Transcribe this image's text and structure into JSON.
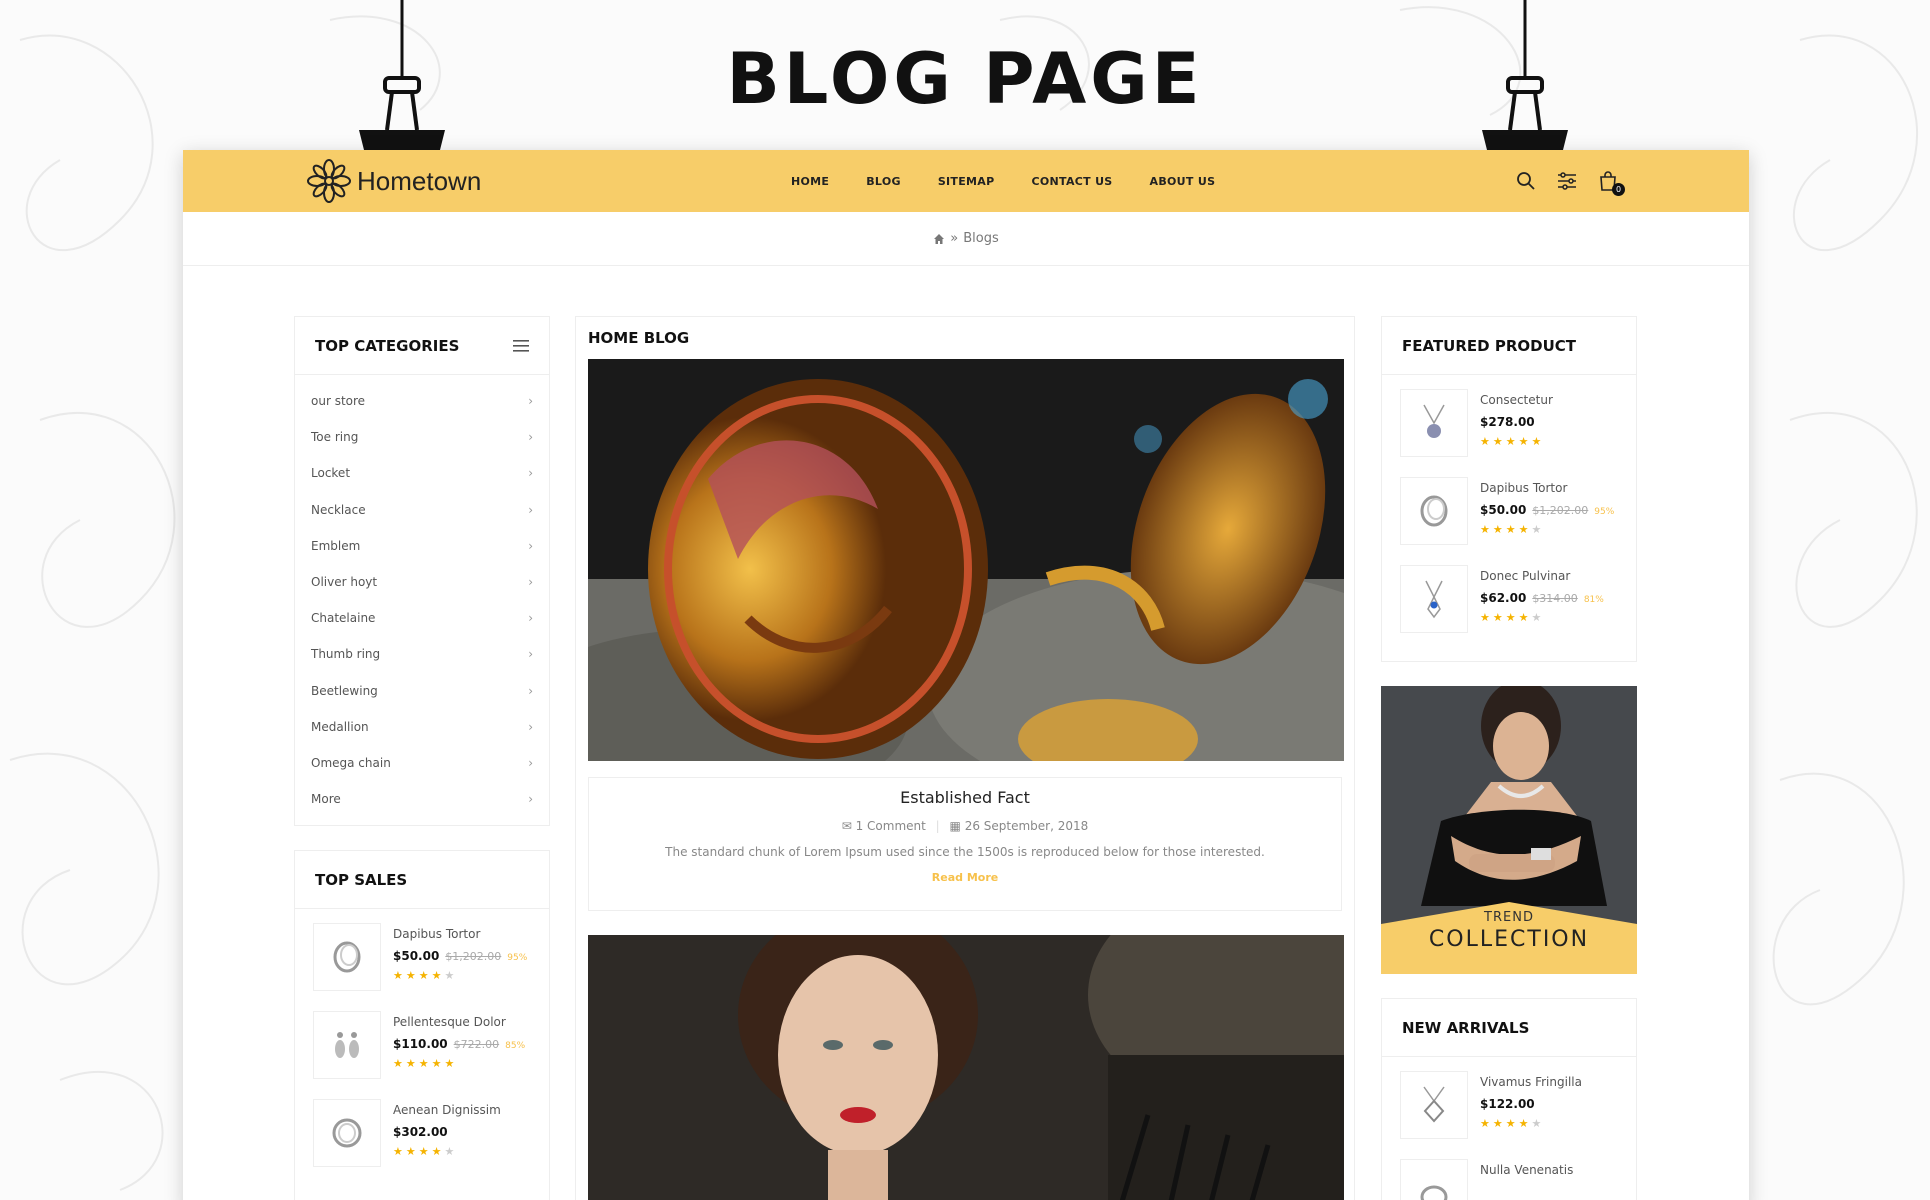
{
  "page_heading": "BLOG PAGE",
  "brand": {
    "name": "Hometown",
    "accent": "#f7cd69"
  },
  "nav": {
    "items": [
      "HOME",
      "BLOG",
      "SITEMAP",
      "CONTACT US",
      "ABOUT US"
    ]
  },
  "header_icons": {
    "search": "search-icon",
    "filter": "sliders-icon",
    "cart": "bag-icon",
    "cart_count": "0"
  },
  "breadcrumb": {
    "home_icon": "home-icon",
    "separator": "»",
    "current": "Blogs"
  },
  "top_categories": {
    "title": "TOP CATEGORIES",
    "items": [
      "our store",
      "Toe ring",
      "Locket",
      "Necklace",
      "Emblem",
      "Oliver hoyt",
      "Chatelaine",
      "Thumb ring",
      "Beetlewing",
      "Medallion",
      "Omega chain",
      "More"
    ]
  },
  "top_sales": {
    "title": "TOP SALES",
    "items": [
      {
        "name": "Dapibus Tortor",
        "price": "$50.00",
        "old_price": "$1,202.00",
        "discount": "95%",
        "rating": 4
      },
      {
        "name": "Pellentesque Dolor",
        "price": "$110.00",
        "old_price": "$722.00",
        "discount": "85%",
        "rating": 5
      },
      {
        "name": "Aenean Dignissim",
        "price": "$302.00",
        "old_price": "",
        "discount": "",
        "rating": 4
      }
    ]
  },
  "home_blog": {
    "title": "HOME BLOG",
    "posts": [
      {
        "title": "Established Fact",
        "comments": "1 Comment",
        "date": "26 September, 2018",
        "excerpt": "The standard chunk of Lorem Ipsum used since the 1500s is reproduced below for those interested.",
        "read_more": "Read More"
      }
    ]
  },
  "featured_product": {
    "title": "FEATURED PRODUCT",
    "items": [
      {
        "name": "Consectetur",
        "price": "$278.00",
        "old_price": "",
        "discount": "",
        "rating": 5
      },
      {
        "name": "Dapibus Tortor",
        "price": "$50.00",
        "old_price": "$1,202.00",
        "discount": "95%",
        "rating": 4
      },
      {
        "name": "Donec Pulvinar",
        "price": "$62.00",
        "old_price": "$314.00",
        "discount": "81%",
        "rating": 4
      }
    ]
  },
  "banner": {
    "line1": "TREND",
    "line2": "COLLECTION"
  },
  "new_arrivals": {
    "title": "NEW ARRIVALS",
    "items": [
      {
        "name": "Vivamus Fringilla",
        "price": "$122.00",
        "rating": 4
      },
      {
        "name": "Nulla Venenatis",
        "price": "",
        "rating": 0
      }
    ]
  }
}
